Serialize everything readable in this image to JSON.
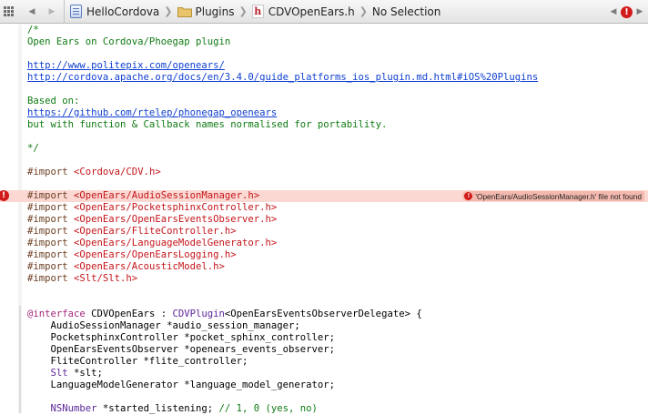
{
  "jumpbar": {
    "back_label": "◀",
    "forward_label": "▶",
    "project": "HelloCordova",
    "group": "Plugins",
    "file": "CDVOpenEars.h",
    "selection": "No Selection",
    "sep": "❯",
    "error_count_icon": "!",
    "nav_prev": "◀",
    "nav_next": "▶"
  },
  "code": {
    "l01": "/*",
    "l02": "Open Ears on Cordova/Phoegap plugin",
    "l04": "http://www.politepix.com/openears/",
    "l05": "http://cordova.apache.org/docs/en/3.4.0/guide_platforms_ios_plugin.md.html#iOS%20Plugins",
    "l07": "Based on:",
    "l08": "https://github.com/rtelep/phonegap_openears",
    "l09": "but with function & Callback names normalised for portability.",
    "l11": "*/",
    "imp": "#import ",
    "l13": "<Cordova/CDV.h>",
    "l15": "<OpenEars/AudioSessionManager.h>",
    "l16": "<OpenEars/PocketsphinxController.h>",
    "l17": "<OpenEars/OpenEarsEventsObserver.h>",
    "l18": "<OpenEars/FliteController.h>",
    "l19": "<OpenEars/LanguageModelGenerator.h>",
    "l20": "<OpenEars/OpenEarsLogging.h>",
    "l21": "<OpenEars/AcousticModel.h>",
    "l22": "<Slt/Slt.h>",
    "iface_kw": "@interface",
    "iface_name": " CDVOpenEars : ",
    "iface_super": "CDVPlugin",
    "iface_proto": "<OpenEarsEventsObserverDelegate> {",
    "m1": "    AudioSessionManager *audio_session_manager;",
    "m2": "    PocketsphinxController *pocket_sphinx_controller;",
    "m3": "    OpenEarsEventsObserver *openears_events_observer;",
    "m4": "    FliteController *flite_controller;",
    "m5_type": "    Slt",
    "m5_rest": " *slt;",
    "m6": "    LanguageModelGenerator *language_model_generator;",
    "m8_type": "    NSNumber",
    "m8_rest": " *started_listening; ",
    "m8_comment": "// 1, 0 (yes, no)"
  },
  "error": {
    "gutter_icon": "!",
    "badge_icon": "!",
    "message": "'OpenEars/AudioSessionManager.h' file not found"
  },
  "colors": {
    "error_line": "#fbd8d2",
    "error_red": "#d11a1a",
    "comment_green": "#0f7a12",
    "string_red": "#c4151a",
    "keyword_purple": "#a5287b"
  }
}
